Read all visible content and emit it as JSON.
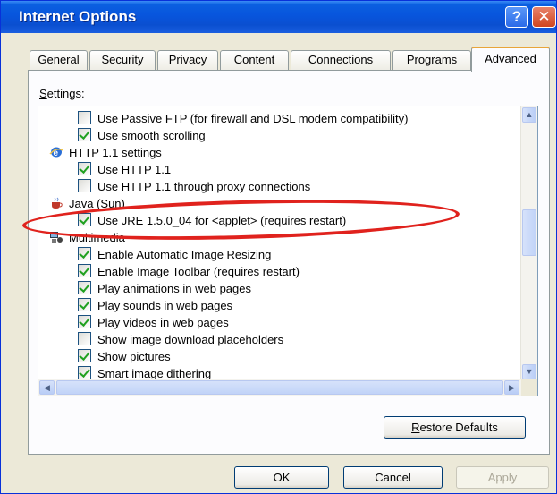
{
  "window": {
    "title": "Internet Options",
    "help_glyph": "?",
    "close_glyph": "✕"
  },
  "tabs": [
    {
      "label": "General",
      "active": false
    },
    {
      "label": "Security",
      "active": false
    },
    {
      "label": "Privacy",
      "active": false
    },
    {
      "label": "Content",
      "active": false
    },
    {
      "label": "Connections",
      "active": false
    },
    {
      "label": "Programs",
      "active": false
    },
    {
      "label": "Advanced",
      "active": true
    }
  ],
  "settings": {
    "label_prefix": "S",
    "label_rest": "ettings:",
    "rows": [
      {
        "kind": "checkbox",
        "checked": false,
        "label": "Use Passive FTP (for firewall and DSL modem compatibility)"
      },
      {
        "kind": "checkbox",
        "checked": true,
        "label": "Use smooth scrolling"
      },
      {
        "kind": "group",
        "icon": "ie-globe-icon",
        "label": "HTTP 1.1 settings"
      },
      {
        "kind": "checkbox",
        "checked": true,
        "label": "Use HTTP 1.1"
      },
      {
        "kind": "checkbox",
        "checked": false,
        "label": "Use HTTP 1.1 through proxy connections"
      },
      {
        "kind": "group",
        "icon": "java-cup-icon",
        "label": "Java (Sun)"
      },
      {
        "kind": "checkbox",
        "checked": true,
        "label": "Use JRE 1.5.0_04 for <applet> (requires restart)"
      },
      {
        "kind": "group",
        "icon": "multimedia-icon",
        "label": "Multimedia"
      },
      {
        "kind": "checkbox",
        "checked": true,
        "label": "Enable Automatic Image Resizing"
      },
      {
        "kind": "checkbox",
        "checked": true,
        "label": "Enable Image Toolbar (requires restart)"
      },
      {
        "kind": "checkbox",
        "checked": true,
        "label": "Play animations in web pages"
      },
      {
        "kind": "checkbox",
        "checked": true,
        "label": "Play sounds in web pages"
      },
      {
        "kind": "checkbox",
        "checked": true,
        "label": "Play videos in web pages"
      },
      {
        "kind": "checkbox",
        "checked": false,
        "label": "Show image download placeholders"
      },
      {
        "kind": "checkbox",
        "checked": true,
        "label": "Show pictures"
      },
      {
        "kind": "checkbox",
        "checked": true,
        "label": "Smart image dithering"
      }
    ]
  },
  "restore_button": {
    "mnemonic": "R",
    "rest": "estore Defaults"
  },
  "footer": {
    "ok_label": "OK",
    "cancel_label": "Cancel",
    "apply_label": "Apply"
  },
  "colors": {
    "title_bar": "#0855dd",
    "highlight_oval": "#e0221d",
    "checkmark": "#21a121",
    "active_tab_accent": "#e8a53a"
  }
}
